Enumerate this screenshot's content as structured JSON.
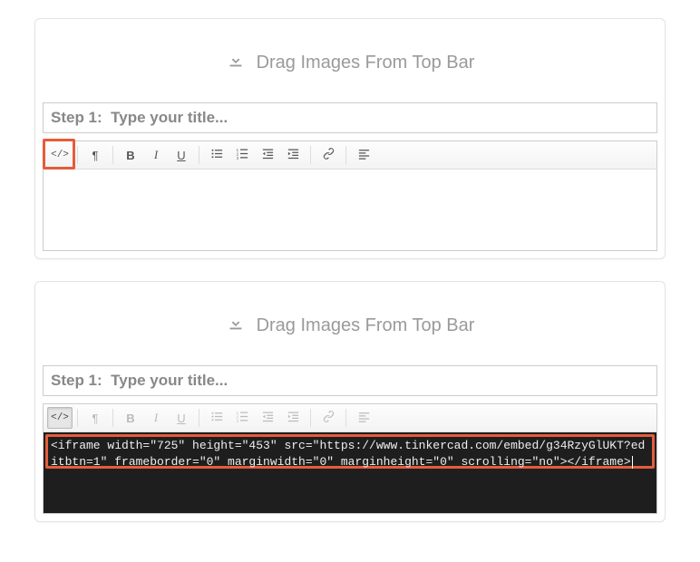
{
  "drop_label": "Drag Images From Top Bar",
  "step_prefix": "Step 1:  ",
  "title_placeholder": "Type your title...",
  "toolbar": {
    "code": "</>",
    "paragraph": "¶",
    "bold": "B",
    "italic": "I",
    "underline": "U"
  },
  "code_content": "<iframe width=\"725\" height=\"453\" src=\"https://www.tinkercad.com/embed/g34RzyGlUKT?editbtn=1\" frameborder=\"0\" marginwidth=\"0\" marginheight=\"0\" scrolling=\"no\"></iframe>"
}
